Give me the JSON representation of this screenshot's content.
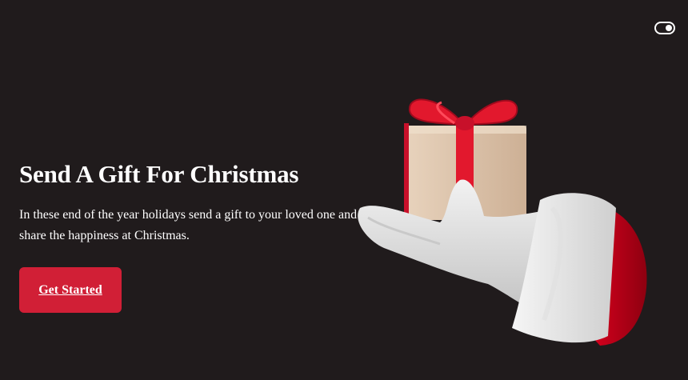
{
  "header": {
    "theme_toggle_icon": "toggle-switch-icon"
  },
  "hero": {
    "title": "Send A Gift For Christmas",
    "description": "In these end of the year holidays send a gift to your loved one and share the happiness at Christmas.",
    "cta_label": "Get Started",
    "illustration": "santa-hand-holding-gift-image"
  },
  "colors": {
    "background": "#201b1c",
    "accent": "#d11f36",
    "text": "#ffffff"
  }
}
